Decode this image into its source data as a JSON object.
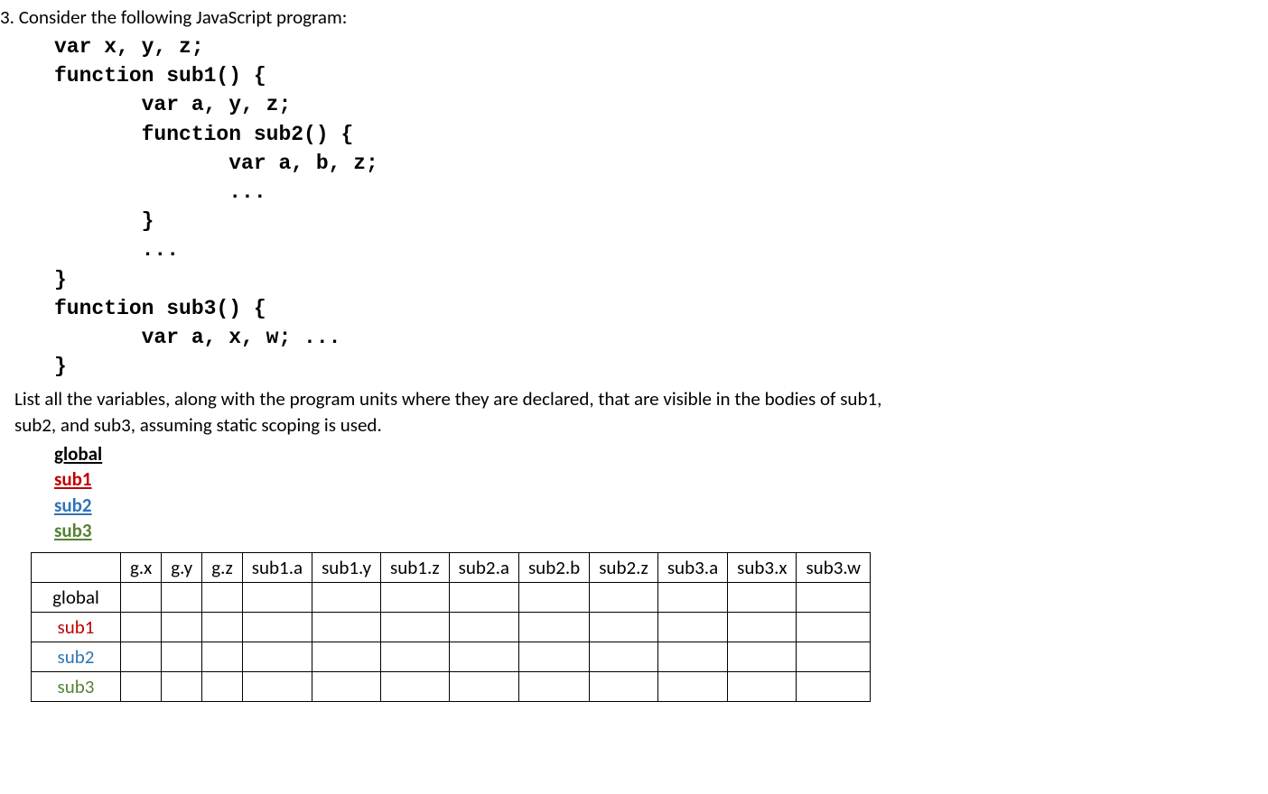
{
  "question": {
    "number_prefix": "3. ",
    "intro": "Consider the following JavaScript program:"
  },
  "code": {
    "line1": "var x, y, z;",
    "line2": "function sub1() {",
    "line3": "       var a, y, z;",
    "line4": "       function sub2() {",
    "line5": "              var a, b, z;",
    "line6": "              ...",
    "line7": "       }",
    "line8": "       ...",
    "line9": "}",
    "line10": "function sub3() {",
    "line11": "       var a, x, w; ...",
    "line12": "}"
  },
  "followup": {
    "line1": "List all the variables, along with the program units where they are declared, that are visible in the bodies of sub1,",
    "line2": "sub2, and sub3, assuming static scoping is used."
  },
  "scopes": {
    "s0": "global",
    "s1": "sub1",
    "s2": "sub2",
    "s3": "sub3"
  },
  "table": {
    "cols": {
      "c0": "g.x",
      "c1": "g.y",
      "c2": "g.z",
      "c3": "sub1.a",
      "c4": "sub1.y",
      "c5": "sub1.z",
      "c6": "sub2.a",
      "c7": "sub2.b",
      "c8": "sub2.z",
      "c9": "sub3.a",
      "c10": "sub3.x",
      "c11": "sub3.w"
    },
    "rows": {
      "r0": "global",
      "r1": "sub1",
      "r2": "sub2",
      "r3": "sub3"
    }
  },
  "colors": {
    "global": "#000000",
    "sub1": "#c00000",
    "sub2": "#2e74b5",
    "sub3": "#548235"
  }
}
